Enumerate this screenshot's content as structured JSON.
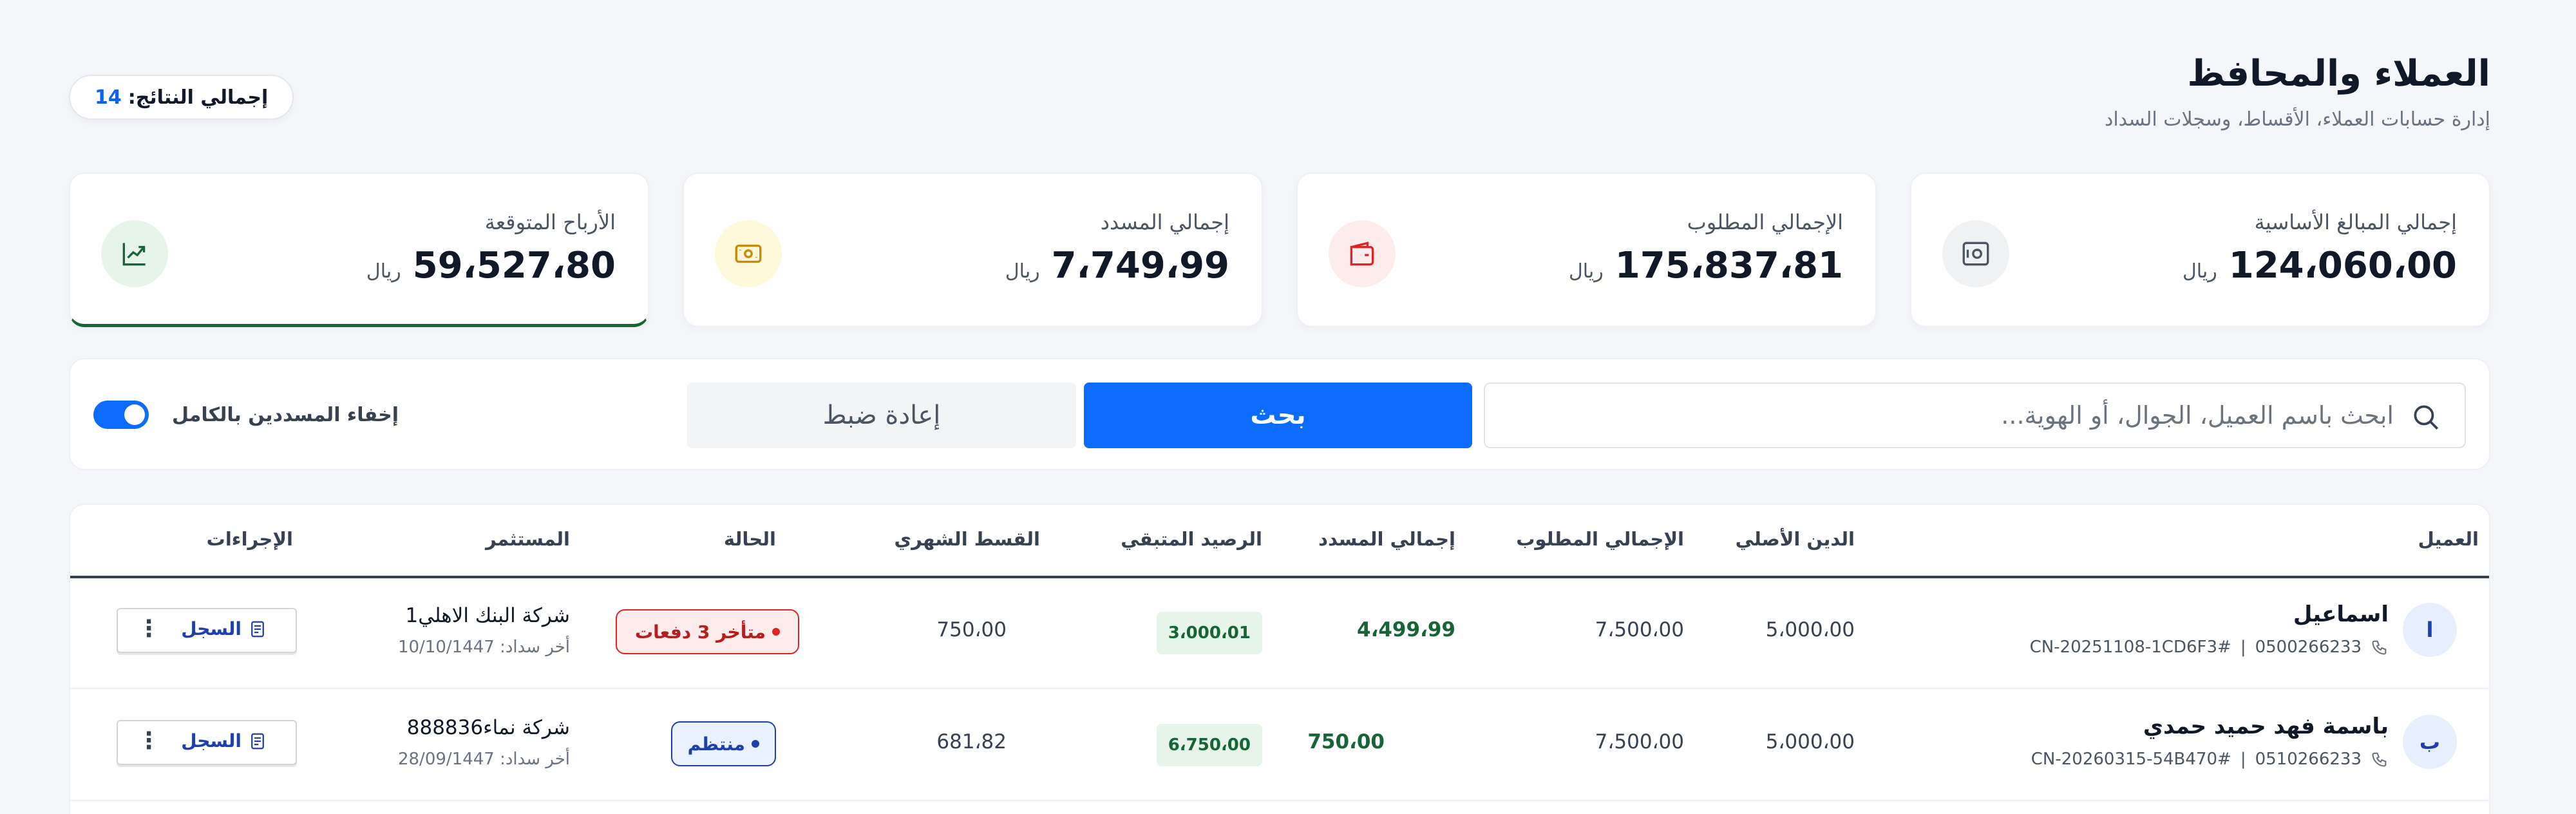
{
  "header": {
    "title": "العملاء والمحافظ",
    "subtitle": "إدارة حسابات العملاء، الأقساط، وسجلات السداد",
    "total_label": "إجمالي النتائج:",
    "total_count": "14"
  },
  "stats": [
    {
      "label": "إجمالي المبالغ الأساسية",
      "amount": "124،060،00",
      "currency": "ريال",
      "icon": "safe-icon"
    },
    {
      "label": "الإجمالي المطلوب",
      "amount": "175،837،81",
      "currency": "ريال",
      "icon": "wallet-icon"
    },
    {
      "label": "إجمالي المسدد",
      "amount": "7،749،99",
      "currency": "ريال",
      "icon": "cash-icon"
    },
    {
      "label": "الأرباح المتوقعة",
      "amount": "59،527،80",
      "currency": "ريال",
      "icon": "trend-up-icon"
    }
  ],
  "search": {
    "placeholder": "ابحث باسم العميل، الجوال، أو الهوية...",
    "search_button": "بحث",
    "reset_button": "إعادة ضبط",
    "toggle_label": "إخفاء المسددين بالكامل",
    "toggle_on": true
  },
  "table": {
    "headers": {
      "client": "العميل",
      "original_debt": "الدين الأصلي",
      "total_required": "الإجمالي المطلوب",
      "total_paid": "إجمالي المسدد",
      "remaining": "الرصيد المتبقي",
      "monthly": "القسط الشهري",
      "status": "الحالة",
      "investor": "المستثمر",
      "actions": "الإجراءات"
    },
    "rows": [
      {
        "avatar": "ا",
        "name": "اسماعيل",
        "phone": "0500266233",
        "code": "CN-20251108-1CD6F3#",
        "original_debt": "5،000،00",
        "total_required": "7،500،00",
        "total_paid": "4،499،99",
        "remaining": "3،000،01",
        "monthly": "750،00",
        "status": "متأخر 3 دفعات",
        "investor": "شركة البنك الاهلي1",
        "last_payment": "أخر سداد: 10/10/1447",
        "record_label": "السجل"
      },
      {
        "avatar": "ب",
        "name": "باسمة فهد حميد حمدي",
        "phone": "0510266233",
        "code": "CN-20260315-54B470#",
        "original_debt": "5،000،00",
        "total_required": "7،500،00",
        "total_paid": "750،00",
        "remaining": "6،750،00",
        "monthly": "681،82",
        "status": "منتظم",
        "investor": "شركة نماء888836",
        "last_payment": "أخر سداد: 28/09/1447",
        "record_label": "السجل"
      }
    ]
  },
  "colors": {
    "primary": "#0b6cff",
    "success": "#166534",
    "danger": "#dc2626",
    "info": "#1e40af"
  }
}
